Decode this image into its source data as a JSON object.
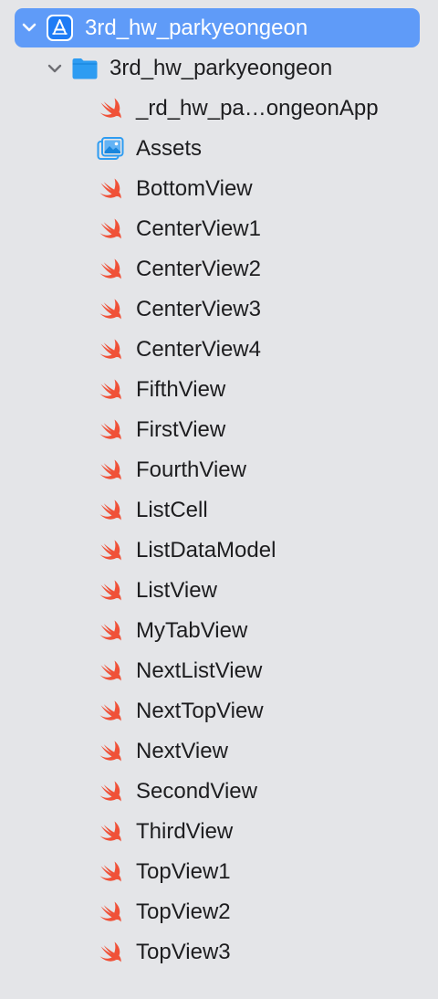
{
  "project": {
    "name": "3rd_hw_parkyeongeon",
    "icon": "xcode-app-icon"
  },
  "group": {
    "name": "3rd_hw_parkyeongeon",
    "icon": "blue-folder-icon"
  },
  "files": [
    {
      "name": "_rd_hw_pa…ongeonApp",
      "icon": "swift-file-icon"
    },
    {
      "name": "Assets",
      "icon": "asset-catalog-icon"
    },
    {
      "name": "BottomView",
      "icon": "swift-file-icon"
    },
    {
      "name": "CenterView1",
      "icon": "swift-file-icon"
    },
    {
      "name": "CenterView2",
      "icon": "swift-file-icon"
    },
    {
      "name": "CenterView3",
      "icon": "swift-file-icon"
    },
    {
      "name": "CenterView4",
      "icon": "swift-file-icon"
    },
    {
      "name": "FifthView",
      "icon": "swift-file-icon"
    },
    {
      "name": "FirstView",
      "icon": "swift-file-icon"
    },
    {
      "name": "FourthView",
      "icon": "swift-file-icon"
    },
    {
      "name": "ListCell",
      "icon": "swift-file-icon"
    },
    {
      "name": "ListDataModel",
      "icon": "swift-file-icon"
    },
    {
      "name": "ListView",
      "icon": "swift-file-icon"
    },
    {
      "name": "MyTabView",
      "icon": "swift-file-icon"
    },
    {
      "name": "NextListView",
      "icon": "swift-file-icon"
    },
    {
      "name": "NextTopView",
      "icon": "swift-file-icon"
    },
    {
      "name": "NextView",
      "icon": "swift-file-icon"
    },
    {
      "name": "SecondView",
      "icon": "swift-file-icon"
    },
    {
      "name": "ThirdView",
      "icon": "swift-file-icon"
    },
    {
      "name": "TopView1",
      "icon": "swift-file-icon"
    },
    {
      "name": "TopView2",
      "icon": "swift-file-icon"
    },
    {
      "name": "TopView3",
      "icon": "swift-file-icon"
    }
  ],
  "colors": {
    "selection": "#5f9bf8",
    "background": "#e4e5e8",
    "swift": "#f05138",
    "folder": "#2d9cf2"
  }
}
